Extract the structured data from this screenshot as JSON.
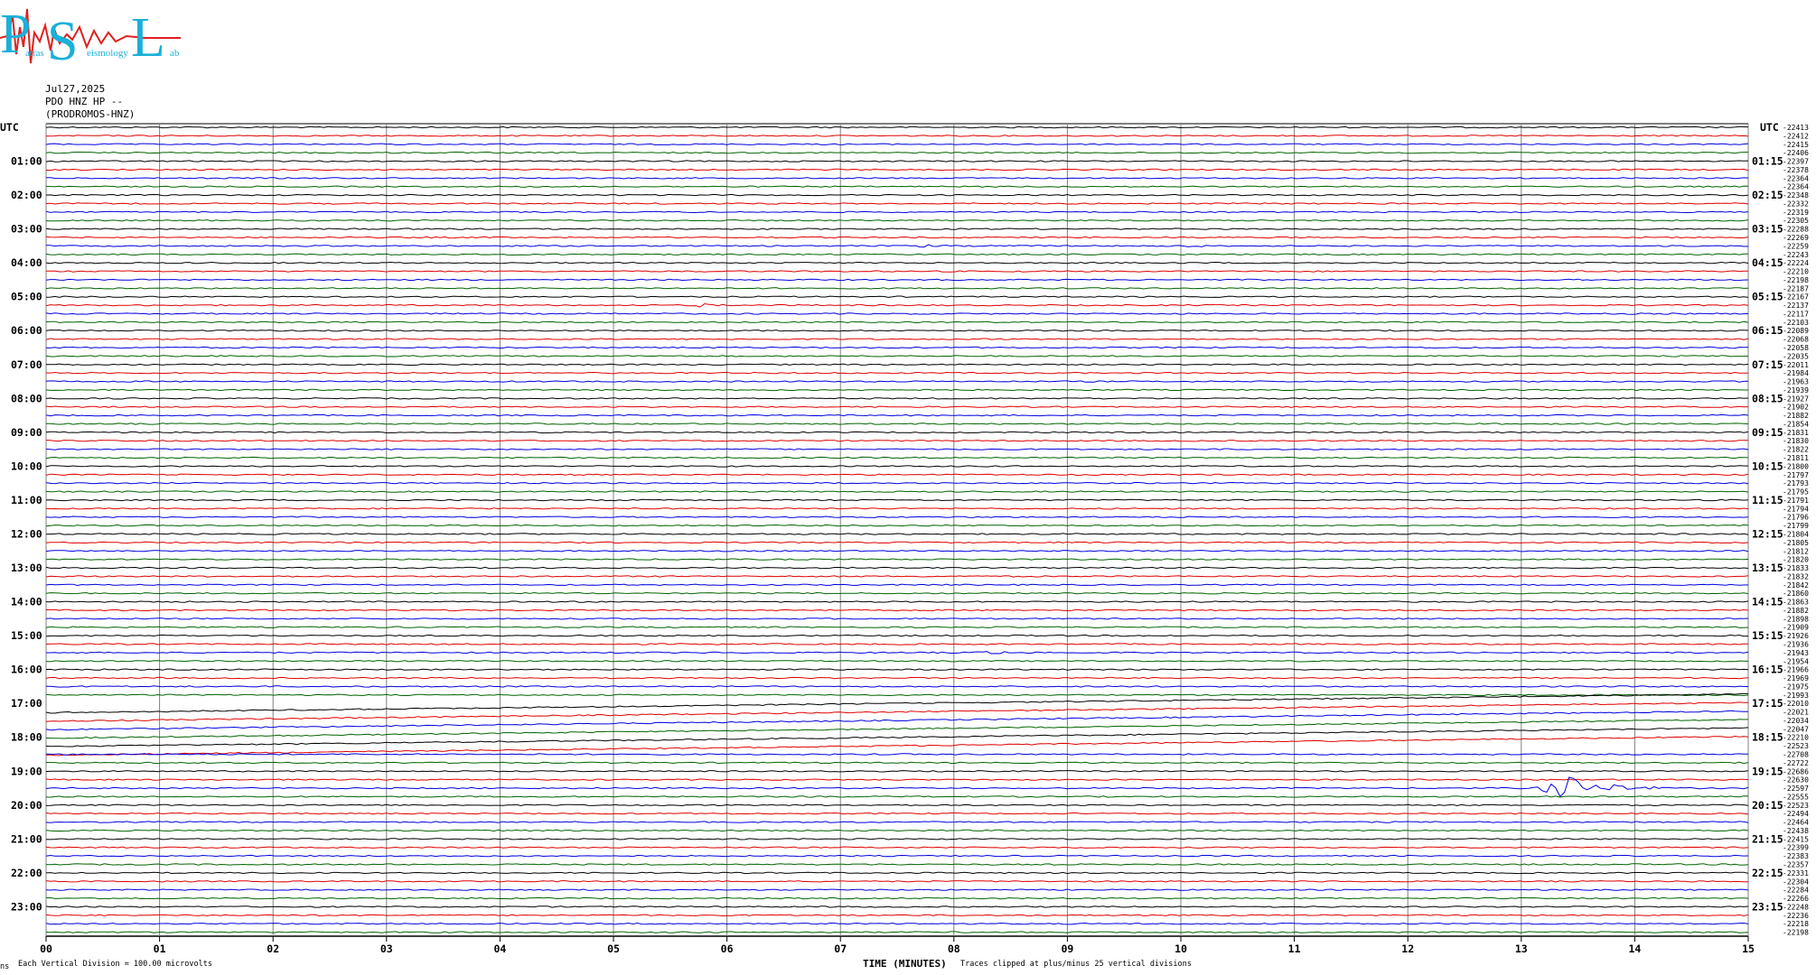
{
  "header": {
    "date": "Jul27,2025",
    "station": "PDO HNZ HP --",
    "location": "(PRODROMOS-HNZ)"
  },
  "colors": {
    "trace_cycle": [
      "#000000",
      "#e00000",
      "#0000e0",
      "#006400"
    ],
    "grid": "#808080",
    "logo_text": "#1ab0d8",
    "logo_wave": "#e02020"
  },
  "logo": {
    "big_letters": [
      "P",
      "S",
      "L"
    ],
    "small_text": [
      "atras",
      "eismology",
      "ab"
    ]
  },
  "chart_data": {
    "type": "line",
    "subtype": "helicorder",
    "axis_label_left": "UTC",
    "axis_label_right": "UTC",
    "xlabel": "TIME (MINUTES)",
    "xlim": [
      0,
      15
    ],
    "x_ticks": [
      "00",
      "01",
      "02",
      "03",
      "04",
      "05",
      "06",
      "07",
      "08",
      "09",
      "10",
      "11",
      "12",
      "13",
      "14",
      "15"
    ],
    "left_hour_labels": [
      "01:00",
      "02:00",
      "03:00",
      "04:00",
      "05:00",
      "06:00",
      "07:00",
      "08:00",
      "09:00",
      "10:00",
      "11:00",
      "12:00",
      "13:00",
      "14:00",
      "15:00",
      "16:00",
      "17:00",
      "18:00",
      "19:00",
      "20:00",
      "21:00",
      "22:00",
      "23:00"
    ],
    "right_hour_labels": [
      "01:15",
      "02:15",
      "03:15",
      "04:15",
      "05:15",
      "06:15",
      "07:15",
      "08:15",
      "09:15",
      "10:15",
      "11:15",
      "12:15",
      "13:15",
      "14:15",
      "15:15",
      "16:15",
      "17:15",
      "18:15",
      "19:15",
      "20:15",
      "21:15",
      "22:15",
      "23:15"
    ],
    "trace_counts": [
      "-22413",
      "-22412",
      "-22415",
      "-22406",
      "-22397",
      "-22378",
      "-22364",
      "-22364",
      "-22348",
      "-22332",
      "-22319",
      "-22305",
      "-22288",
      "-22269",
      "-22259",
      "-22243",
      "-22224",
      "-22210",
      "-22198",
      "-22187",
      "-22167",
      "-22137",
      "-22117",
      "-22103",
      "-22089",
      "-22068",
      "-22058",
      "-22035",
      "-22011",
      "-21984",
      "-21963",
      "-21939",
      "-21927",
      "-21902",
      "-21882",
      "-21854",
      "-21831",
      "-21830",
      "-21822",
      "-21811",
      "-21800",
      "-21797",
      "-21793",
      "-21795",
      "-21791",
      "-21794",
      "-21796",
      "-21799",
      "-21804",
      "-21805",
      "-21812",
      "-21820",
      "-21833",
      "-21832",
      "-21842",
      "-21860",
      "-21863",
      "-21882",
      "-21898",
      "-21909",
      "-21926",
      "-21936",
      "-21943",
      "-21954",
      "-21966",
      "-21969",
      "-21975",
      "-21993",
      "-22010",
      "-22021",
      "-22034",
      "-22047",
      "-22210",
      "-22523",
      "-22708",
      "-22722",
      "-22686",
      "-22630",
      "-22597",
      "-22555",
      "-22523",
      "-22494",
      "-22464",
      "-22438",
      "-22415",
      "-22399",
      "-22383",
      "-22357",
      "-22331",
      "-22304",
      "-22284",
      "-22266",
      "-22248",
      "-22236",
      "-22218",
      "-22198"
    ],
    "events": [
      {
        "trace_time": "03:30",
        "minute": 7.8,
        "amplitude": "small",
        "color_index": 2
      },
      {
        "trace_time": "03:30",
        "minute": 10.1,
        "amplitude": "small",
        "color_index": 2
      },
      {
        "trace_time": "05:15",
        "minute": 5.8,
        "amplitude": "small",
        "color_index": 2
      },
      {
        "trace_time": "15:30",
        "minute": 8.35,
        "amplitude": "small",
        "color_index": 2
      },
      {
        "trace_time": "19:30",
        "minute": 13.4,
        "amplitude": "large",
        "color_index": 1
      }
    ],
    "drift": {
      "from_trace_time": "17:00",
      "to_trace_time": "18:15",
      "description": "long-period baseline drift"
    },
    "footer_left": "Each Vertical Division =  100.00 microvolts",
    "footer_mid": "Traces clipped at plus/minus 25 vertical divisions",
    "footer_tiny": "ns"
  }
}
